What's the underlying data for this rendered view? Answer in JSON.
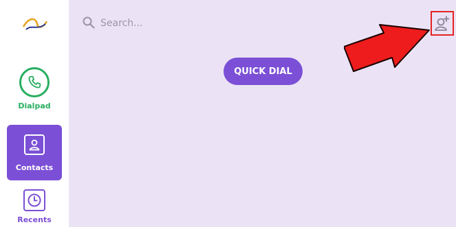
{
  "search": {
    "placeholder": "Search..."
  },
  "main": {
    "quick_dial_label": "QUICK DIAL"
  },
  "sidebar": {
    "items": [
      {
        "label": "Dialpad",
        "icon": "phone-icon",
        "color": "#27ae60"
      },
      {
        "label": "Contacts",
        "icon": "contact-icon",
        "color": "#7b4fd6",
        "active": true
      },
      {
        "label": "Recents",
        "icon": "clock-icon",
        "color": "#7b4fd6"
      }
    ]
  },
  "header": {
    "add_contact_icon": "add-contact-icon"
  },
  "colors": {
    "accent": "#7b4fd6",
    "green": "#27ae60",
    "background": "#ebe3f5",
    "highlight": "#e52222"
  }
}
